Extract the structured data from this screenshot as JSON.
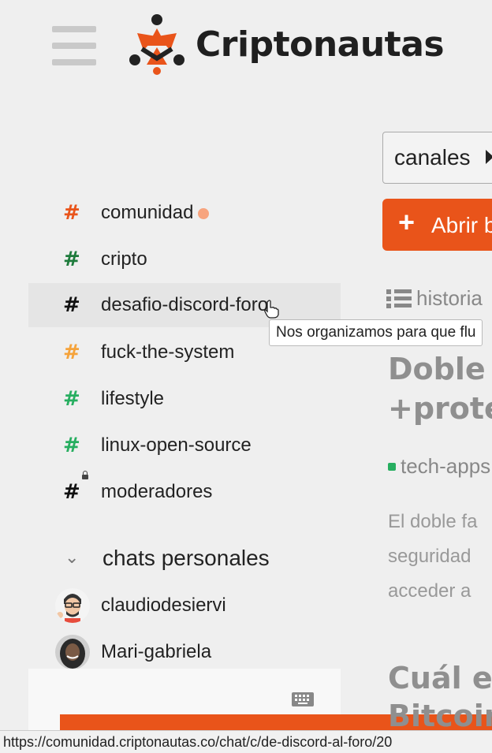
{
  "header": {
    "menu_icon": "hamburger-icon",
    "logo_text": "Criptonautas"
  },
  "sidebar": {
    "channels": [
      {
        "label": "comunidad",
        "hash_color": "#e9541a",
        "unread": true
      },
      {
        "label": "cripto",
        "hash_color": "#1e7b3c"
      },
      {
        "label": "desafio-discord-foro",
        "hash_color": "#111111",
        "active": true
      },
      {
        "label": "fuck-the-system",
        "hash_color": "#f5a33b"
      },
      {
        "label": "lifestyle",
        "hash_color": "#27ae60"
      },
      {
        "label": "linux-open-source",
        "hash_color": "#27ae60"
      },
      {
        "label": "moderadores",
        "hash_color": "#111111",
        "locked": true
      }
    ],
    "dm_section_title": "chats personales",
    "dms": [
      {
        "label": "claudiodesiervi"
      },
      {
        "label": "Mari-gabriela"
      }
    ]
  },
  "main": {
    "dropdown_label": "canales",
    "new_topic_button": "Abrir b",
    "history_label": "historia",
    "post_title_lines": [
      "Doble f",
      "+prote"
    ],
    "tag_label": "tech-apps",
    "excerpt_lines": [
      "El doble fa",
      "seguridad",
      "acceder a"
    ],
    "second_title_lines": [
      "Cuál es",
      "Bitcoin"
    ]
  },
  "tooltip": {
    "text": "Nos organizamos para que flu"
  },
  "status_bar": {
    "url": "https://comunidad.criptonautas.co/chat/c/de-discord-al-foro/20"
  },
  "colors": {
    "accent": "#e9541a"
  }
}
